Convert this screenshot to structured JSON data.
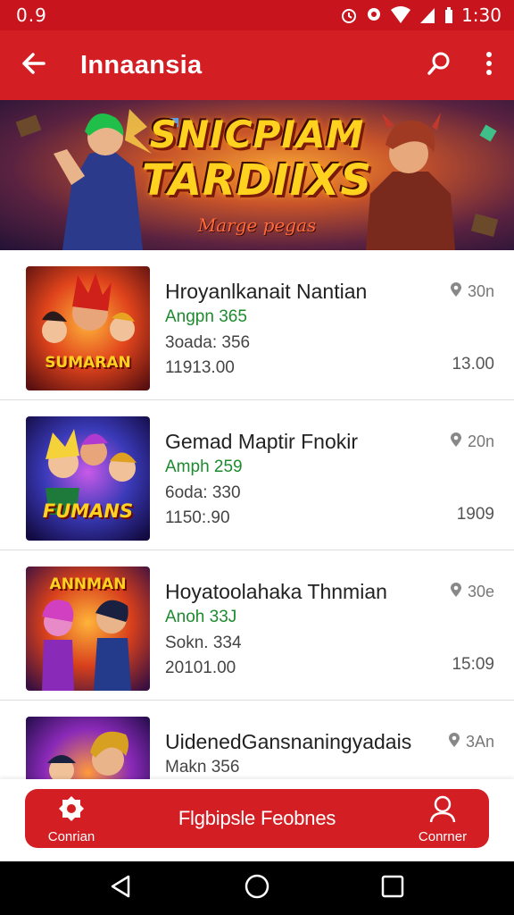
{
  "status_bar": {
    "left_text": "0.9",
    "time": "1:30"
  },
  "app_bar": {
    "title": "Innaansia",
    "back_icon": "arrow-left-icon",
    "search_icon": "search-icon",
    "more_icon": "more-vert-icon"
  },
  "banner": {
    "title_line1": "SNICPIAM",
    "title_line2": "TARDIIXS",
    "subtitle": "Marge pegas"
  },
  "games": [
    {
      "name": "Hroyanlkanait Nantian",
      "price": "Angpn 365",
      "stat": "3oada: 356",
      "date": "11913.00",
      "distance": "30n",
      "time": "13.00",
      "thumb_text": "SUMARAN"
    },
    {
      "name": "Gemad Maptir Fnokir",
      "price": "Amph 259",
      "stat": "6oda: 330",
      "date": "1150:.90",
      "distance": "20n",
      "time": "1909",
      "thumb_text": "FUMANS"
    },
    {
      "name": "Hoyatoolahaka Thnmian",
      "price": "Anoh 33J",
      "stat": "Sokn. 334",
      "date": "20101.00",
      "distance": "30e",
      "time": "15:09",
      "thumb_text": "ANNMAN"
    },
    {
      "name": "UidenedGansnaningyadais",
      "price": "Makn 356",
      "stat": "",
      "date": "",
      "distance": "3An",
      "time": "",
      "thumb_text": ""
    }
  ],
  "bottom_bar": {
    "left_label": "Conrian",
    "center_label": "Flgbipsle Feobnes",
    "right_label": "Conrner"
  },
  "colors": {
    "primary": "#d31f24",
    "status": "#c8141c",
    "price_green": "#1e8a2e"
  }
}
